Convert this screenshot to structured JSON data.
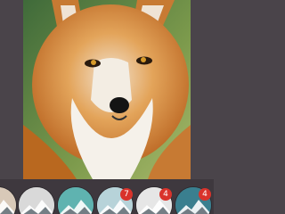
{
  "photo": {
    "subject_icon": "fox-photo",
    "background_color": "#6d8a4a"
  },
  "filters": [
    {
      "icon": "mountain-thumbnail",
      "tone": "#d8c9b8",
      "badge": ""
    },
    {
      "icon": "mountain-thumbnail",
      "tone": "#d9d9d9",
      "badge": ""
    },
    {
      "icon": "mountain-thumbnail",
      "tone": "#5fb3b0",
      "badge": ""
    },
    {
      "icon": "mountain-thumbnail",
      "tone": "#b7d3d9",
      "badge": "7"
    },
    {
      "icon": "mountain-thumbnail",
      "tone": "#e6e6e6",
      "badge": "4"
    },
    {
      "icon": "mountain-thumbnail",
      "tone": "#3a7f8f",
      "badge": "4"
    }
  ],
  "colors": {
    "app_background": "#4a444a",
    "strip_background": "#3e383e",
    "badge": "#d9332b"
  }
}
